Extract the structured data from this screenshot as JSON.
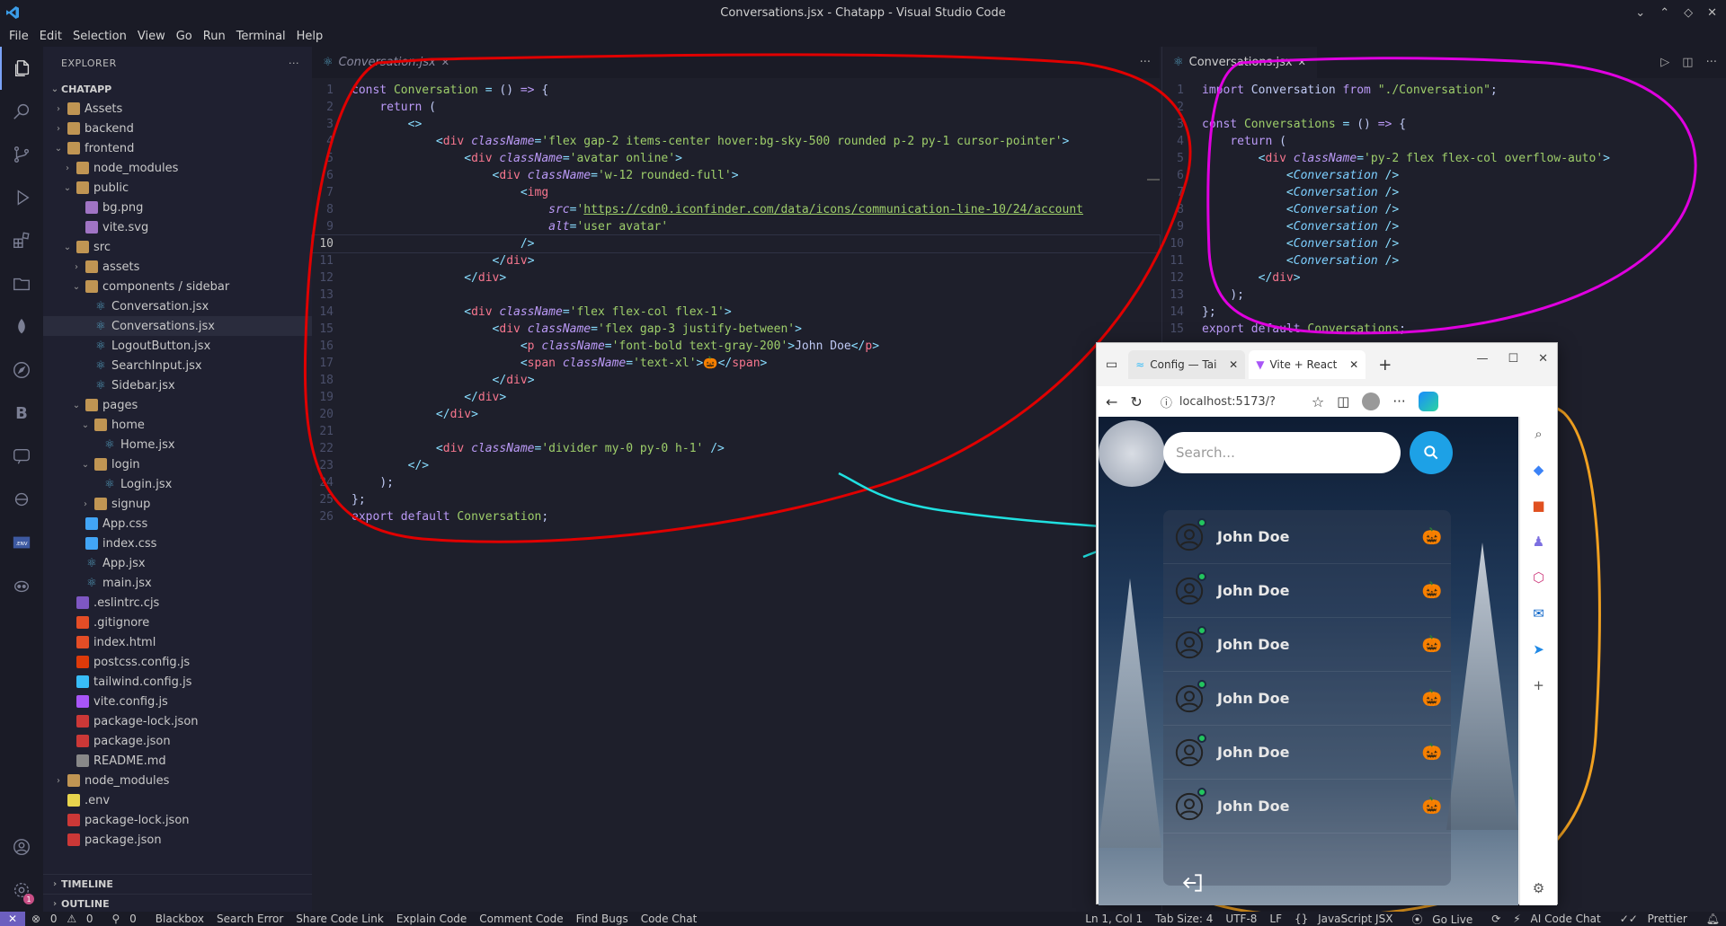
{
  "window": {
    "title": "Conversations.jsx - Chatapp - Visual Studio Code"
  },
  "menu": [
    "File",
    "Edit",
    "Selection",
    "View",
    "Go",
    "Run",
    "Terminal",
    "Help"
  ],
  "explorer": {
    "header": "EXPLORER",
    "root": "CHATAPP",
    "tree": [
      {
        "label": "Assets",
        "depth": 1,
        "kind": "folder",
        "open": false
      },
      {
        "label": "backend",
        "depth": 1,
        "kind": "folder",
        "open": false
      },
      {
        "label": "frontend",
        "depth": 1,
        "kind": "folder",
        "open": true
      },
      {
        "label": "node_modules",
        "depth": 2,
        "kind": "folder",
        "open": false
      },
      {
        "label": "public",
        "depth": 2,
        "kind": "folder",
        "open": true
      },
      {
        "label": "bg.png",
        "depth": 3,
        "kind": "png"
      },
      {
        "label": "vite.svg",
        "depth": 3,
        "kind": "svg"
      },
      {
        "label": "src",
        "depth": 2,
        "kind": "folder",
        "open": true
      },
      {
        "label": "assets",
        "depth": 3,
        "kind": "folder",
        "open": false
      },
      {
        "label": "components / sidebar",
        "depth": 3,
        "kind": "folder",
        "open": true
      },
      {
        "label": "Conversation.jsx",
        "depth": 4,
        "kind": "jsx"
      },
      {
        "label": "Conversations.jsx",
        "depth": 4,
        "kind": "jsx",
        "selected": true
      },
      {
        "label": "LogoutButton.jsx",
        "depth": 4,
        "kind": "jsx"
      },
      {
        "label": "SearchInput.jsx",
        "depth": 4,
        "kind": "jsx"
      },
      {
        "label": "Sidebar.jsx",
        "depth": 4,
        "kind": "jsx"
      },
      {
        "label": "pages",
        "depth": 3,
        "kind": "folder",
        "open": true
      },
      {
        "label": "home",
        "depth": 4,
        "kind": "folder",
        "open": true
      },
      {
        "label": "Home.jsx",
        "depth": 5,
        "kind": "jsx"
      },
      {
        "label": "login",
        "depth": 4,
        "kind": "folder",
        "open": true
      },
      {
        "label": "Login.jsx",
        "depth": 5,
        "kind": "jsx"
      },
      {
        "label": "signup",
        "depth": 4,
        "kind": "folder",
        "open": false
      },
      {
        "label": "App.css",
        "depth": 3,
        "kind": "css"
      },
      {
        "label": "index.css",
        "depth": 3,
        "kind": "css"
      },
      {
        "label": "App.jsx",
        "depth": 3,
        "kind": "jsx"
      },
      {
        "label": "main.jsx",
        "depth": 3,
        "kind": "jsx"
      },
      {
        "label": ".eslintrc.cjs",
        "depth": 2,
        "kind": "eslint"
      },
      {
        "label": ".gitignore",
        "depth": 2,
        "kind": "git"
      },
      {
        "label": "index.html",
        "depth": 2,
        "kind": "html"
      },
      {
        "label": "postcss.config.js",
        "depth": 2,
        "kind": "postcss"
      },
      {
        "label": "tailwind.config.js",
        "depth": 2,
        "kind": "tailwind"
      },
      {
        "label": "vite.config.js",
        "depth": 2,
        "kind": "vite"
      },
      {
        "label": "package-lock.json",
        "depth": 2,
        "kind": "npm"
      },
      {
        "label": "package.json",
        "depth": 2,
        "kind": "npm"
      },
      {
        "label": "README.md",
        "depth": 2,
        "kind": "md"
      },
      {
        "label": "node_modules",
        "depth": 1,
        "kind": "folder",
        "open": false
      },
      {
        "label": ".env",
        "depth": 1,
        "kind": "env"
      },
      {
        "label": "package-lock.json",
        "depth": 1,
        "kind": "npm"
      },
      {
        "label": "package.json",
        "depth": 1,
        "kind": "npm"
      }
    ],
    "timeline": "TIMELINE",
    "outline": "OUTLINE"
  },
  "editor_left": {
    "tab": "Conversation.jsx",
    "current_line": 10,
    "lines": [
      "<span class='k'>const</span> <span class='fn'>Conversation</span> <span class='p'>=</span> <span class='c'>()</span> <span class='k'>=&gt;</span> <span class='c'>{</span>",
      "    <span class='k'>return</span> <span class='c'>(</span>",
      "        <span class='p'>&lt;&gt;</span>",
      "            <span class='p'>&lt;</span><span class='t'>div</span> <span class='a'>className</span><span class='p'>=</span><span class='s'>'flex gap-2 items-center hover:bg-sky-500 rounded p-2 py-1 cursor-pointer'</span><span class='p'>&gt;</span>",
      "                <span class='p'>&lt;</span><span class='t'>div</span> <span class='a'>className</span><span class='p'>=</span><span class='s'>'avatar online'</span><span class='p'>&gt;</span>",
      "                    <span class='p'>&lt;</span><span class='t'>div</span> <span class='a'>className</span><span class='p'>=</span><span class='s'>'w-12 rounded-full'</span><span class='p'>&gt;</span>",
      "                        <span class='p'>&lt;</span><span class='t'>img</span>",
      "                            <span class='a'>src</span><span class='p'>=</span><span class='s'>'</span><span class='u'>https://cdn0.iconfinder.com/data/icons/communication-line-10/24/account</span>",
      "                            <span class='a'>alt</span><span class='p'>=</span><span class='s'>'user avatar'</span>",
      "                        <span class='p'>/&gt;</span>",
      "                    <span class='p'>&lt;/</span><span class='t'>div</span><span class='p'>&gt;</span>",
      "                <span class='p'>&lt;/</span><span class='t'>div</span><span class='p'>&gt;</span>",
      "",
      "                <span class='p'>&lt;</span><span class='t'>div</span> <span class='a'>className</span><span class='p'>=</span><span class='s'>'flex flex-col flex-1'</span><span class='p'>&gt;</span>",
      "                    <span class='p'>&lt;</span><span class='t'>div</span> <span class='a'>className</span><span class='p'>=</span><span class='s'>'flex gap-3 justify-between'</span><span class='p'>&gt;</span>",
      "                        <span class='p'>&lt;</span><span class='t'>p</span> <span class='a'>className</span><span class='p'>=</span><span class='s'>'font-bold text-gray-200'</span><span class='p'>&gt;</span><span class='c'>John Doe</span><span class='p'>&lt;/</span><span class='t'>p</span><span class='p'>&gt;</span>",
      "                        <span class='p'>&lt;</span><span class='t'>span</span> <span class='a'>className</span><span class='p'>=</span><span class='s'>'text-xl'</span><span class='p'>&gt;</span><span class='c'>🎃</span><span class='p'>&lt;/</span><span class='t'>span</span><span class='p'>&gt;</span>",
      "                    <span class='p'>&lt;/</span><span class='t'>div</span><span class='p'>&gt;</span>",
      "                <span class='p'>&lt;/</span><span class='t'>div</span><span class='p'>&gt;</span>",
      "            <span class='p'>&lt;/</span><span class='t'>div</span><span class='p'>&gt;</span>",
      "",
      "            <span class='p'>&lt;</span><span class='t'>div</span> <span class='a'>className</span><span class='p'>=</span><span class='s'>'divider my-0 py-0 h-1'</span> <span class='p'>/&gt;</span>",
      "        <span class='p'>&lt;/&gt;</span>",
      "    <span class='c'>);</span>",
      "<span class='c'>};</span>",
      "<span class='k'>export</span> <span class='k'>default</span> <span class='fn'>Conversation</span><span class='c'>;</span>"
    ]
  },
  "editor_right": {
    "tab": "Conversations.jsx",
    "lines": [
      "<span class='k'>import</span> <span class='c'>Conversation</span> <span class='k'>from</span> <span class='s'>\"./Conversation\"</span><span class='c'>;</span>",
      "",
      "<span class='k'>const</span> <span class='fn'>Conversations</span> <span class='p'>=</span> <span class='c'>()</span> <span class='k'>=&gt;</span> <span class='c'>{</span>",
      "    <span class='k'>return</span> <span class='c'>(</span>",
      "        <span class='p'>&lt;</span><span class='t'>div</span> <span class='a'>className</span><span class='p'>=</span><span class='s'>'py-2 flex flex-col overflow-auto'</span><span class='p'>&gt;</span>",
      "            <span class='p'>&lt;</span><span class='comp'>Conversation</span> <span class='p'>/&gt;</span>",
      "            <span class='p'>&lt;</span><span class='comp'>Conversation</span> <span class='p'>/&gt;</span>",
      "            <span class='p'>&lt;</span><span class='comp'>Conversation</span> <span class='p'>/&gt;</span>",
      "            <span class='p'>&lt;</span><span class='comp'>Conversation</span> <span class='p'>/&gt;</span>",
      "            <span class='p'>&lt;</span><span class='comp'>Conversation</span> <span class='p'>/&gt;</span>",
      "            <span class='p'>&lt;</span><span class='comp'>Conversation</span> <span class='p'>/&gt;</span>",
      "        <span class='p'>&lt;/</span><span class='t'>div</span><span class='p'>&gt;</span>",
      "    <span class='c'>);</span>",
      "<span class='c'>};</span>",
      "<span class='k'>export</span> <span class='k'>default</span> <span class='fn'>Conversations</span><span class='c'>;</span>"
    ]
  },
  "browser": {
    "tabs": [
      "Config — Tai",
      "Vite + React"
    ],
    "address": "localhost:5173/?",
    "search_placeholder": "Search...",
    "conversations": [
      {
        "name": "John Doe",
        "emoji": "🎃"
      },
      {
        "name": "John Doe",
        "emoji": "🎃"
      },
      {
        "name": "John Doe",
        "emoji": "🎃"
      },
      {
        "name": "John Doe",
        "emoji": "🎃"
      },
      {
        "name": "John Doe",
        "emoji": "🎃"
      },
      {
        "name": "John Doe",
        "emoji": "🎃"
      }
    ]
  },
  "statusbar": {
    "errors": "0",
    "warnings": "0",
    "ports": "0",
    "items_left": [
      "Blackbox",
      "Search Error",
      "Share Code Link",
      "Explain Code",
      "Comment Code",
      "Find Bugs",
      "Code Chat"
    ],
    "position": "Ln 1, Col 1",
    "tab_size": "Tab Size: 4",
    "encoding": "UTF-8",
    "eol": "LF",
    "language": "JavaScript JSX",
    "go_live": "Go Live",
    "ai_chat": "AI Code Chat",
    "prettier": "Prettier"
  },
  "colors": {
    "annotation_red": "#e00000",
    "annotation_magenta": "#e000e0",
    "annotation_orange": "#f0a020",
    "annotation_cyan": "#20e0e0"
  }
}
